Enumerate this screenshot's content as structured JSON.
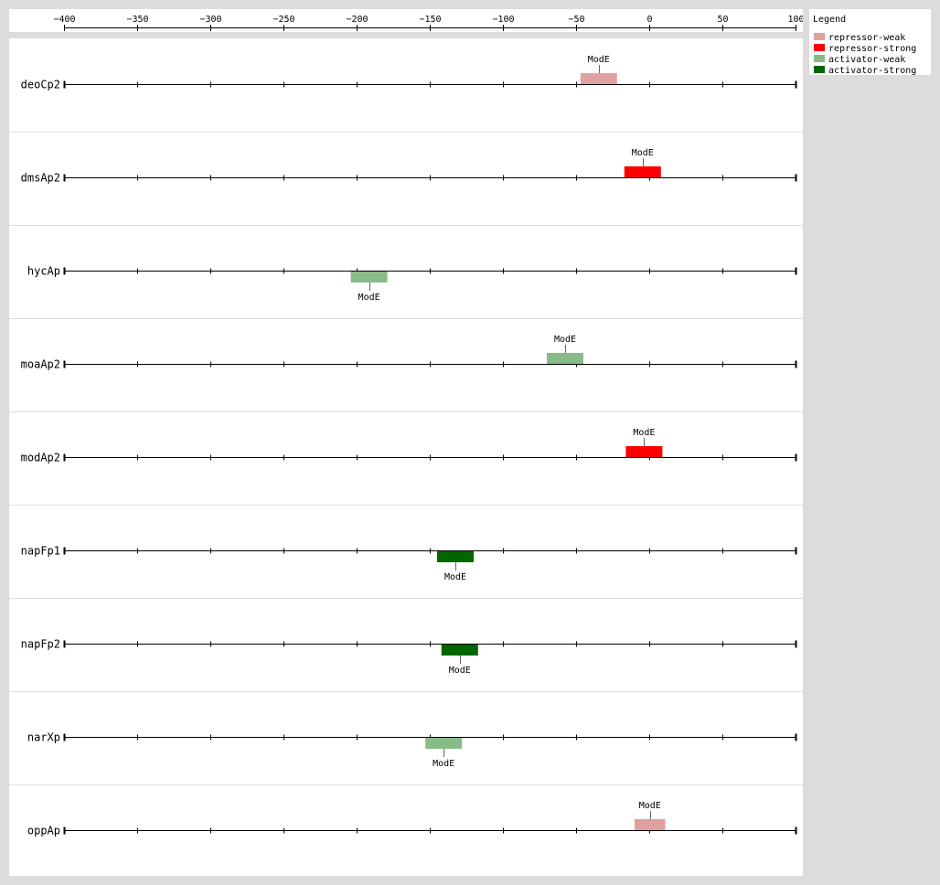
{
  "axis": {
    "ticks": [
      -400,
      -350,
      -300,
      -250,
      -200,
      -150,
      -100,
      -50,
      0,
      50,
      100
    ],
    "range": [
      -400,
      100
    ]
  },
  "legend": {
    "title": "Legend",
    "items": [
      {
        "label": "repressor-weak",
        "color": "#e0a0a0"
      },
      {
        "label": "repressor-strong",
        "color": "#ff0000"
      },
      {
        "label": "activator-weak",
        "color": "#88bb88"
      },
      {
        "label": "activator-strong",
        "color": "#006600"
      }
    ]
  },
  "promoters": [
    {
      "name": "deoCp2",
      "sites": [
        {
          "label": "ModE",
          "start": -47,
          "end": -22,
          "type": "repressor-weak",
          "side": "above"
        }
      ]
    },
    {
      "name": "dmsAp2",
      "sites": [
        {
          "label": "ModE",
          "start": -17,
          "end": 8,
          "type": "repressor-strong",
          "side": "above"
        }
      ]
    },
    {
      "name": "hycAp",
      "sites": [
        {
          "label": "ModE",
          "start": -204,
          "end": -179,
          "type": "activator-weak",
          "side": "below"
        }
      ]
    },
    {
      "name": "moaAp2",
      "sites": [
        {
          "label": "ModE",
          "start": -70,
          "end": -45,
          "type": "activator-weak",
          "side": "above"
        }
      ]
    },
    {
      "name": "modAp2",
      "sites": [
        {
          "label": "ModE",
          "start": -16,
          "end": 9,
          "type": "repressor-strong",
          "side": "above"
        }
      ]
    },
    {
      "name": "napFp1",
      "sites": [
        {
          "label": "ModE",
          "start": -145,
          "end": -120,
          "type": "activator-strong",
          "side": "below"
        }
      ]
    },
    {
      "name": "napFp2",
      "sites": [
        {
          "label": "ModE",
          "start": -142,
          "end": -117,
          "type": "activator-strong",
          "side": "below"
        }
      ]
    },
    {
      "name": "narXp",
      "sites": [
        {
          "label": "ModE",
          "start": -153,
          "end": -128,
          "type": "activator-weak",
          "side": "below"
        }
      ]
    },
    {
      "name": "oppAp",
      "sites": [
        {
          "label": "ModE",
          "start": -10,
          "end": 11,
          "type": "repressor-weak",
          "side": "above"
        }
      ]
    }
  ]
}
